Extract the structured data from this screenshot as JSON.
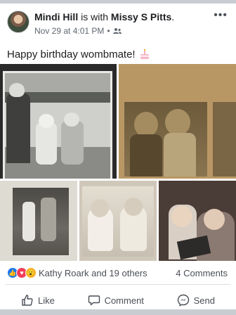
{
  "post": {
    "author": "Mindi Hill",
    "with_text": "is with",
    "tagged": "Missy S Pitts",
    "period": ".",
    "timestamp": "Nov 29 at 4:01 PM",
    "separator": "•",
    "privacy_icon": "friends-icon",
    "text": "Happy birthday wombmate!",
    "emoji_icon": "birthday-cake-icon"
  },
  "reactions": {
    "icons": [
      "like-icon",
      "love-icon",
      "wow-icon"
    ],
    "summary": "Kathy Roark and 19 others",
    "comments": "4 Comments"
  },
  "actions": {
    "like": "Like",
    "comment": "Comment",
    "send": "Send"
  },
  "colors": {
    "like": "#1877f2",
    "love": "#f33e58",
    "wow": "#f7b125",
    "meta": "#606770"
  }
}
